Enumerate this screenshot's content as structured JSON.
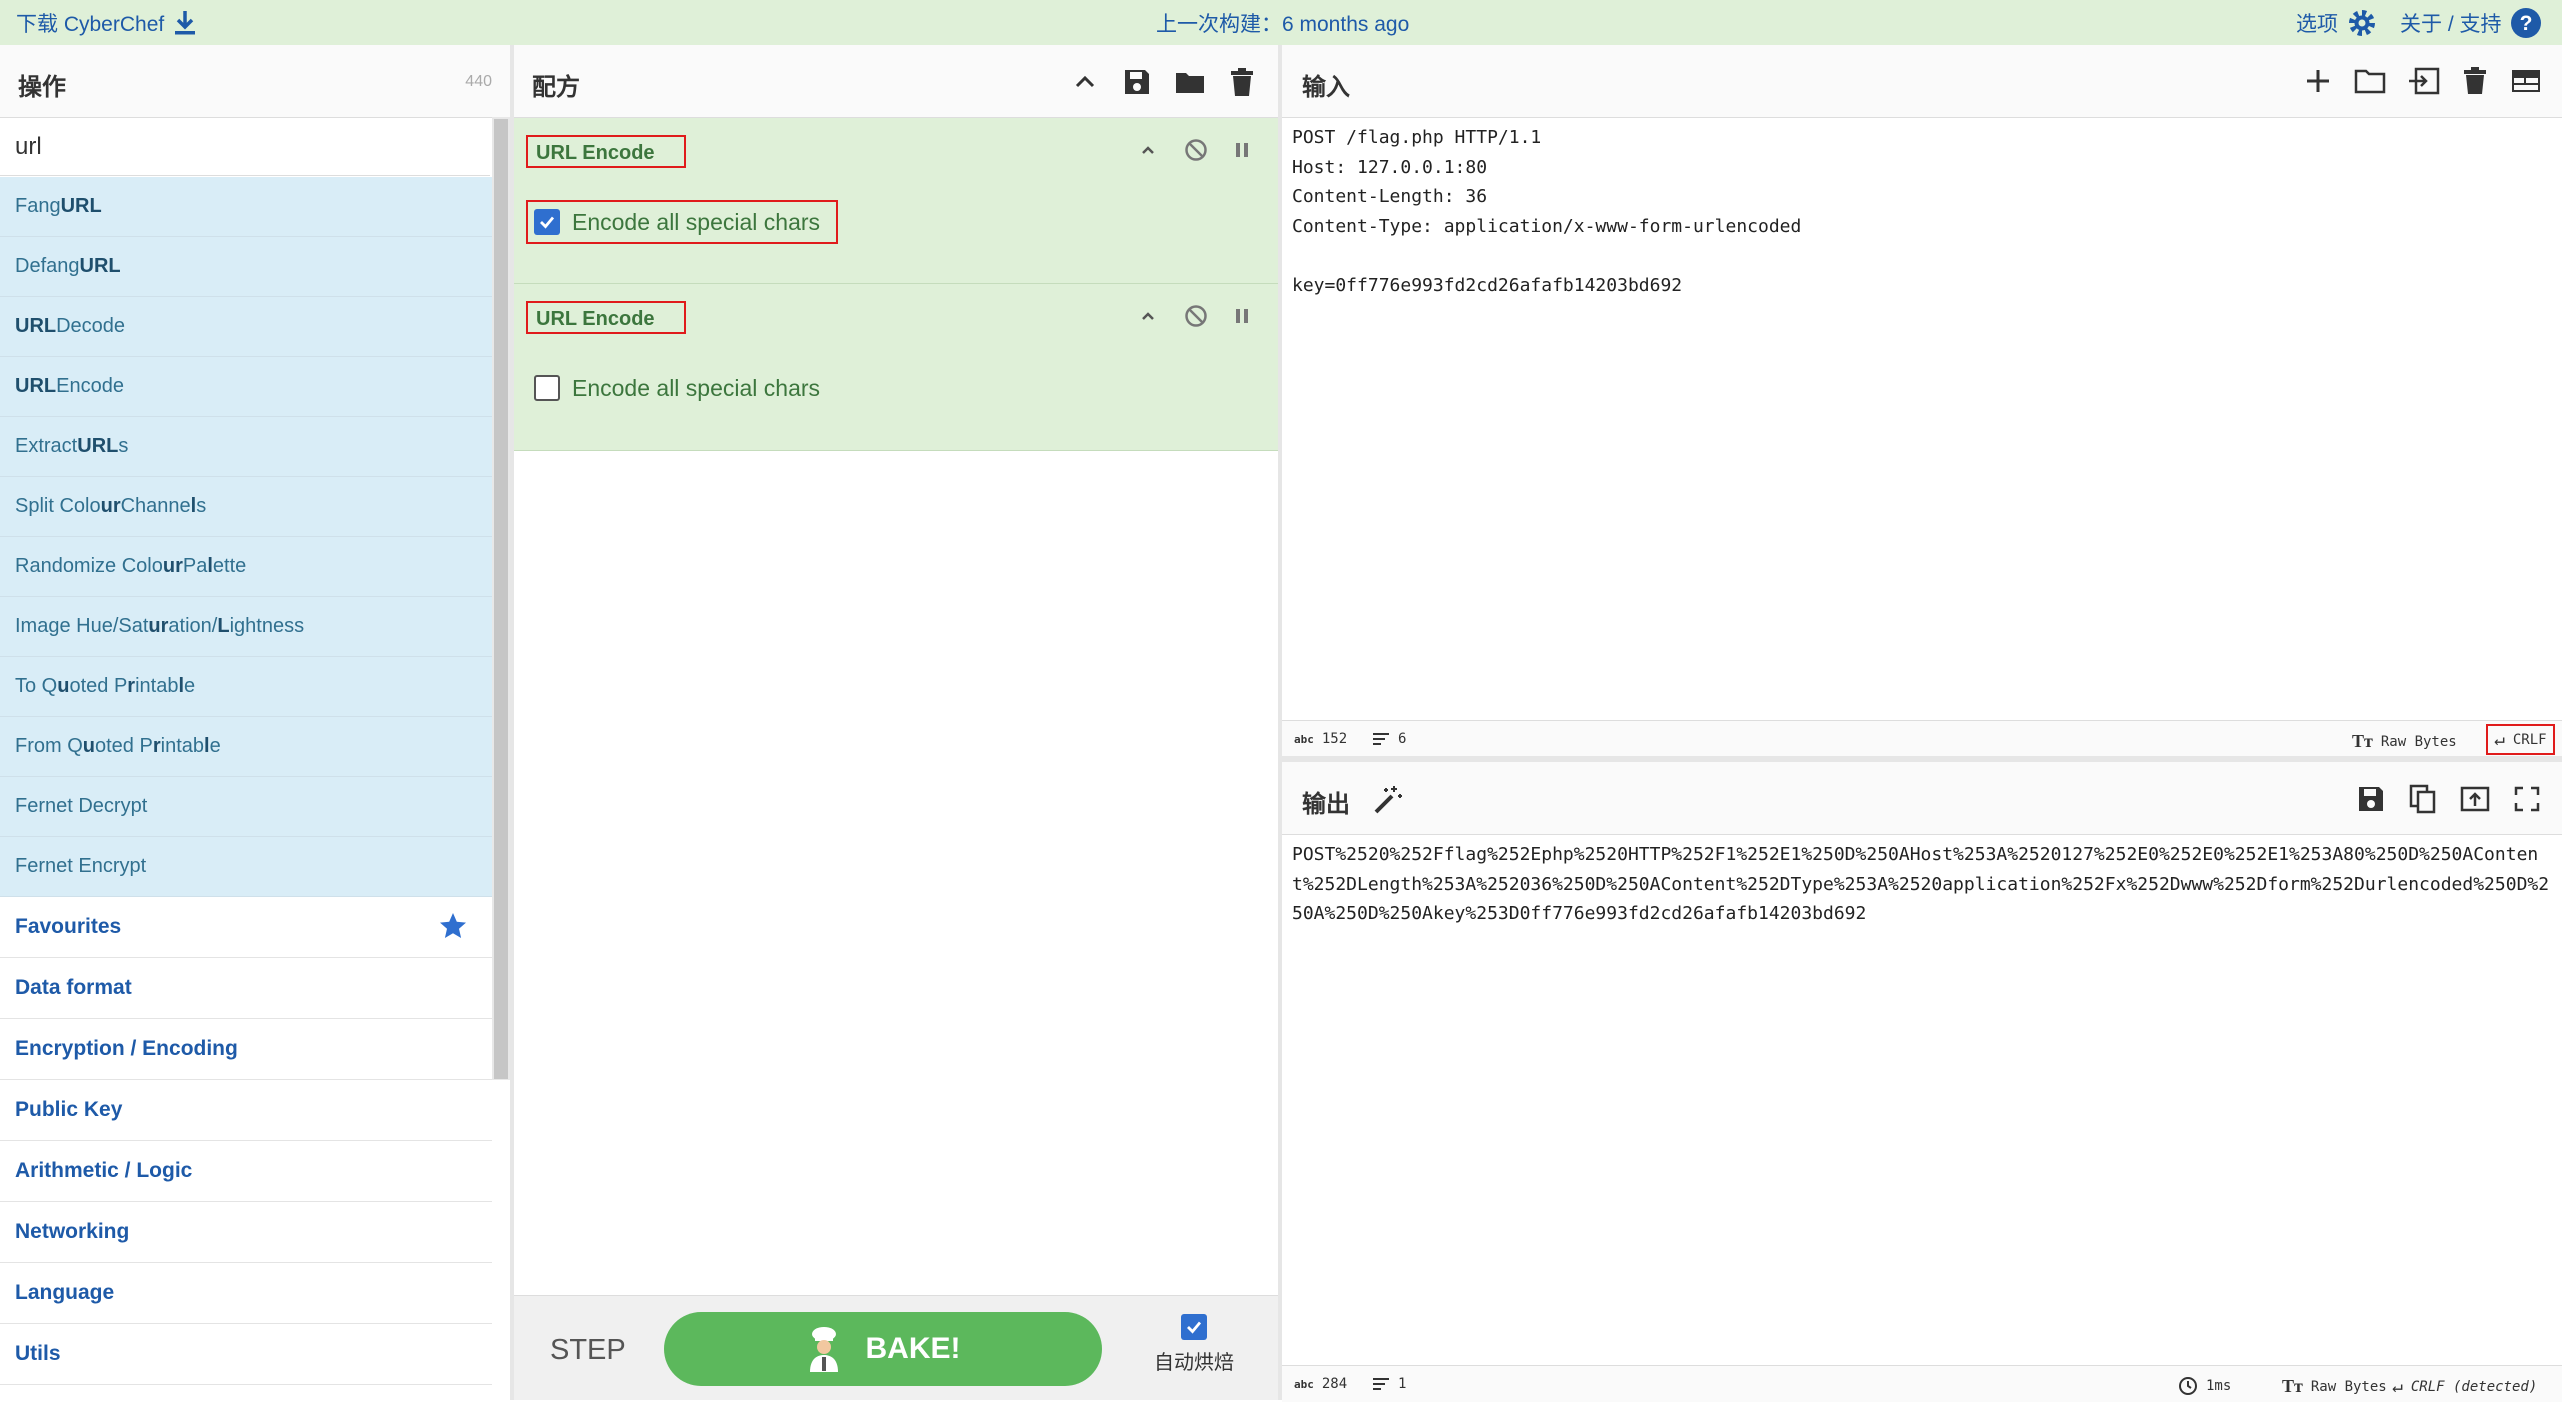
{
  "topbar": {
    "download_label": "下载 CyberChef",
    "last_build": "上一次构建：6 months ago",
    "options_label": "选项",
    "about_label": "关于 / 支持"
  },
  "operations": {
    "title": "操作",
    "count": "440",
    "search_value": "url",
    "results": [
      {
        "pre": "Fang ",
        "hl": "URL",
        "post": ""
      },
      {
        "pre": "Defang ",
        "hl": "URL",
        "post": ""
      },
      {
        "pre": "",
        "hl": "URL",
        "post": " Decode"
      },
      {
        "pre": "",
        "hl": "URL",
        "post": " Encode"
      },
      {
        "pre": "Extract ",
        "hl": "URL",
        "post": "s"
      },
      {
        "pre": "Split Colo",
        "hl": "ur",
        "post": " Channe",
        "hl2": "l",
        "post2": "s"
      },
      {
        "pre": "Randomize Colo",
        "hl": "ur",
        "post": " Pa",
        "hl2": "l",
        "post2": "ette"
      },
      {
        "pre": "Image Hue/Sat",
        "hl": "ur",
        "post": "ation/",
        "hl2": "L",
        "post2": "ightness"
      },
      {
        "pre": "To Q",
        "hl": "u",
        "post": "oted P",
        "hl2": "r",
        "post2": "intab",
        "hl3": "l",
        "post3": "e"
      },
      {
        "pre": "From Q",
        "hl": "u",
        "post": "oted P",
        "hl2": "r",
        "post2": "intab",
        "hl3": "l",
        "post3": "e"
      },
      {
        "pre": "Fernet Decrypt",
        "hl": "",
        "post": ""
      },
      {
        "pre": "Fernet Encrypt",
        "hl": "",
        "post": ""
      }
    ],
    "categories": [
      "Favourites",
      "Data format",
      "Encryption / Encoding",
      "Public Key",
      "Arithmetic / Logic",
      "Networking",
      "Language",
      "Utils"
    ]
  },
  "recipe": {
    "title": "配方",
    "ops": [
      {
        "name": "URL Encode",
        "option_label": "Encode all special chars",
        "checked": true
      },
      {
        "name": "URL Encode",
        "option_label": "Encode all special chars",
        "checked": false
      }
    ],
    "step_label": "STEP",
    "bake_label": "BAKE!",
    "auto_bake_label": "自动烘焙"
  },
  "input": {
    "title": "输入",
    "text": "POST /flag.php HTTP/1.1\nHost: 127.0.0.1:80\nContent-Length: 36\nContent-Type: application/x-www-form-urlencoded\n\nkey=0ff776e993fd2cd26afafb14203bd692",
    "status": {
      "length_tag": "abc",
      "length": "152",
      "lines": "6",
      "raw_bytes": "Raw Bytes",
      "eol": "CRLF"
    }
  },
  "output": {
    "title": "输出",
    "text": "POST%2520%252Fflag%252Ephp%2520HTTP%252F1%252E1%250D%250AHost%253A%2520127%252E0%252E0%252E1%253A80%250D%250AContent%252DLength%253A%252036%250D%250AContent%252DType%253A%2520application%252Fx%252Dwww%252Dform%252Durlencoded%250D%250A%250D%250Akey%253D0ff776e993fd2cd26afafb14203bd692",
    "status": {
      "length_tag": "abc",
      "length": "284",
      "lines": "1",
      "time": "1ms",
      "raw_bytes": "Raw Bytes",
      "eol": "CRLF (detected)"
    }
  }
}
